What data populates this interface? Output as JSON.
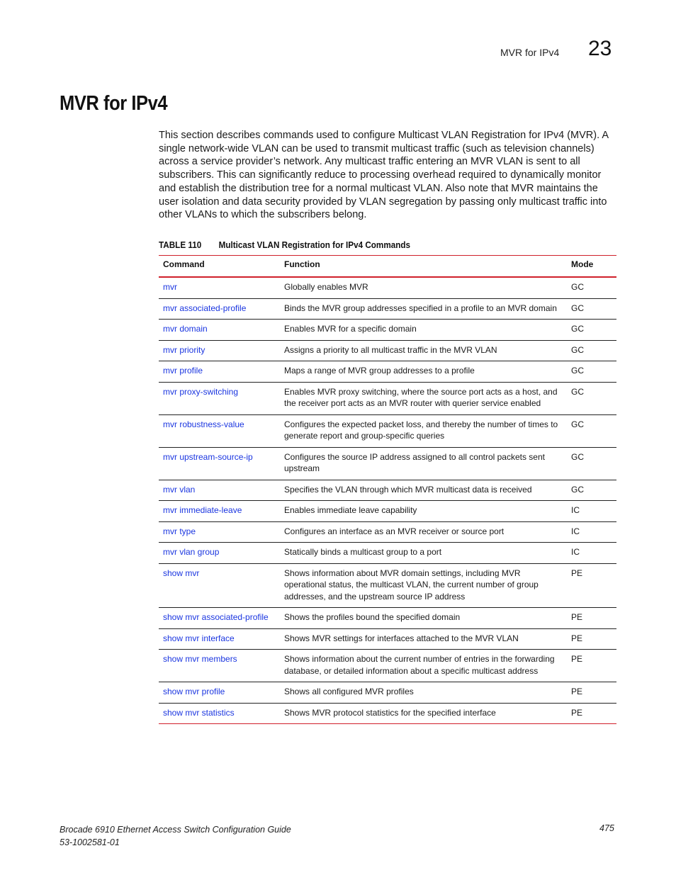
{
  "header": {
    "section_title": "MVR for IPv4",
    "chapter_number": "23"
  },
  "page_title": "MVR for IPv4",
  "intro_paragraph": "This section describes commands used to configure Multicast VLAN Registration for IPv4 (MVR). A single network-wide VLAN can be used to transmit multicast traffic (such as television channels) across a service provider’s network. Any multicast traffic entering an MVR VLAN is sent to all subscribers. This can significantly reduce to processing overhead required to dynamically monitor and establish the distribution tree for a normal multicast VLAN. Also note that MVR maintains the user isolation and data security provided by VLAN segregation by passing only multicast traffic into other VLANs to which the subscribers belong.",
  "table": {
    "caption_number": "TABLE 110",
    "caption_title": "Multicast VLAN Registration for IPv4 Commands",
    "columns": [
      "Command",
      "Function",
      "Mode"
    ],
    "rows": [
      {
        "command": "mvr",
        "function": "Globally enables MVR",
        "mode": "GC"
      },
      {
        "command": "mvr associated-profile",
        "function": "Binds the MVR group addresses specified in a profile to an MVR domain",
        "mode": "GC"
      },
      {
        "command": "mvr domain",
        "function": "Enables MVR for a specific domain",
        "mode": "GC"
      },
      {
        "command": "mvr priority",
        "function": "Assigns a priority to all multicast traffic in the MVR VLAN",
        "mode": "GC"
      },
      {
        "command": "mvr profile",
        "function": "Maps a range of MVR group addresses to a profile",
        "mode": "GC"
      },
      {
        "command": "mvr proxy-switching",
        "function": "Enables MVR proxy switching, where the source port acts as a host, and the receiver port acts as an MVR router with querier service enabled",
        "mode": "GC"
      },
      {
        "command": "mvr robustness-value",
        "function": "Configures the expected packet loss, and thereby the number of times to generate report and group-specific queries",
        "mode": "GC"
      },
      {
        "command": "mvr upstream-source-ip",
        "function": "Configures the source IP address assigned to all control packets sent upstream",
        "mode": "GC"
      },
      {
        "command": "mvr vlan",
        "function": "Specifies the VLAN through which MVR multicast data is received",
        "mode": "GC"
      },
      {
        "command": "mvr immediate-leave",
        "function": "Enables immediate leave capability",
        "mode": "IC"
      },
      {
        "command": "mvr type",
        "function": "Configures an interface as an MVR receiver or source port",
        "mode": "IC"
      },
      {
        "command": "mvr vlan group",
        "function": "Statically binds a multicast group to a port",
        "mode": "IC"
      },
      {
        "command": "show mvr",
        "function": "Shows information about MVR domain settings, including MVR operational status, the multicast VLAN, the current number of group addresses, and the upstream source IP address",
        "mode": "PE"
      },
      {
        "command": "show mvr associated-profile",
        "function": "Shows the profiles bound the specified domain",
        "mode": "PE"
      },
      {
        "command": "show mvr interface",
        "function": "Shows MVR settings for interfaces attached to the MVR VLAN",
        "mode": "PE"
      },
      {
        "command": "show mvr members",
        "function": "Shows information about the current number of entries in the forwarding database, or detailed information about a specific multicast address",
        "mode": "PE"
      },
      {
        "command": "show mvr profile",
        "function": "Shows all configured MVR profiles",
        "mode": "PE"
      },
      {
        "command": "show mvr statistics",
        "function": "Shows MVR protocol statistics for the specified interface",
        "mode": "PE"
      }
    ]
  },
  "footer": {
    "guide_title": "Brocade 6910 Ethernet Access Switch Configuration Guide",
    "doc_number": "53-1002581-01",
    "page_number": "475"
  },
  "colors": {
    "link": "#1a35e0",
    "rule_red": "#d0202a"
  }
}
